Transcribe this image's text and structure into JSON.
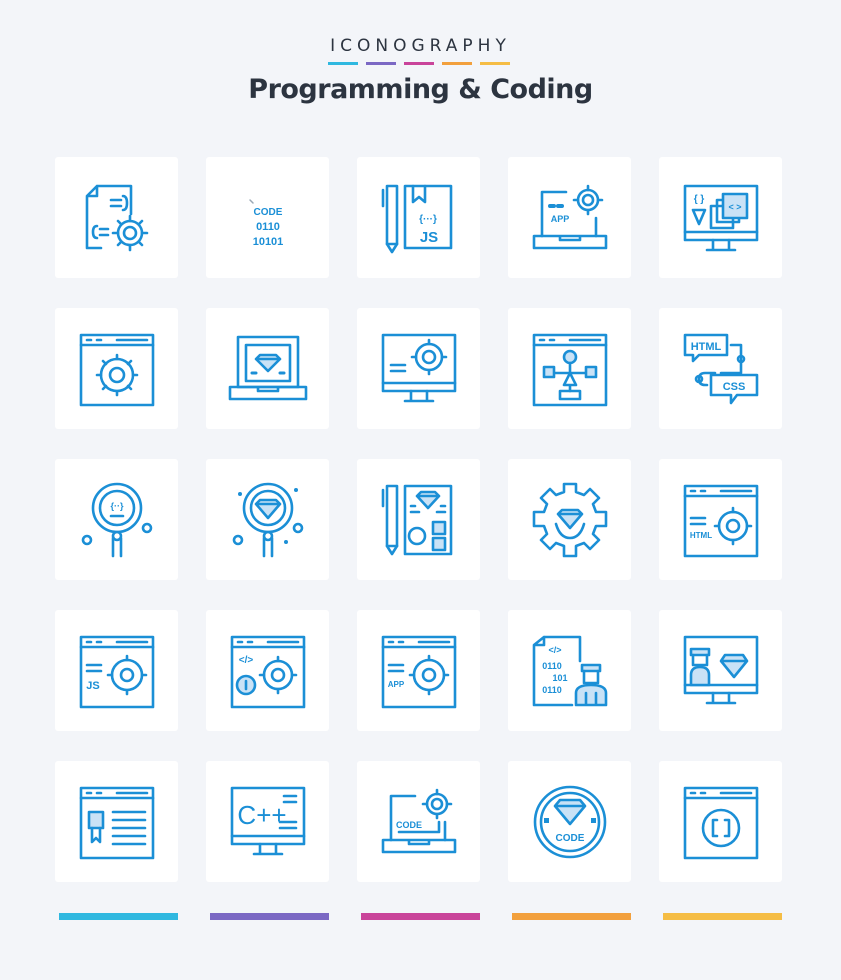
{
  "header": {
    "brand": "ICONOGRAPHY",
    "title": "Programming & Coding",
    "accent_colors": [
      "#2fb8e0",
      "#7b68c4",
      "#c9449a",
      "#f2a03d",
      "#f5bd45"
    ]
  },
  "icon_color": "#1b8fd6",
  "icons": [
    {
      "name": "code-settings-document-icon"
    },
    {
      "name": "binary-code-icon",
      "labels": [
        "CODE",
        "0110",
        "10101"
      ]
    },
    {
      "name": "javascript-book-pencil-icon",
      "labels": [
        "{···}",
        "JS"
      ]
    },
    {
      "name": "laptop-app-settings-icon",
      "labels": [
        "APP"
      ]
    },
    {
      "name": "monitor-code-layers-icon",
      "labels": [
        "{ }",
        "< >"
      ]
    },
    {
      "name": "browser-settings-icon"
    },
    {
      "name": "laptop-diamond-icon"
    },
    {
      "name": "monitor-settings-icon"
    },
    {
      "name": "browser-flowchart-icon"
    },
    {
      "name": "html-css-chat-icon",
      "labels": [
        "HTML",
        "CSS"
      ]
    },
    {
      "name": "magnifier-code-icon",
      "labels": [
        "{··}"
      ]
    },
    {
      "name": "magnifier-diamond-icon"
    },
    {
      "name": "pencil-diamond-document-icon"
    },
    {
      "name": "gear-diamond-icon"
    },
    {
      "name": "browser-html-settings-icon",
      "labels": [
        "HTML"
      ]
    },
    {
      "name": "browser-js-settings-icon",
      "labels": [
        "JS"
      ]
    },
    {
      "name": "browser-code-info-settings-icon",
      "labels": [
        "</>"
      ]
    },
    {
      "name": "browser-app-settings-icon",
      "labels": [
        "APP"
      ]
    },
    {
      "name": "developer-binary-document-icon",
      "labels": [
        "</>",
        "0110",
        "101",
        "0110"
      ]
    },
    {
      "name": "monitor-developer-diamond-icon"
    },
    {
      "name": "browser-certificate-icon"
    },
    {
      "name": "monitor-cpp-icon",
      "labels": [
        "C++"
      ]
    },
    {
      "name": "laptop-code-settings-icon",
      "labels": [
        "CODE"
      ]
    },
    {
      "name": "diamond-code-badge-icon",
      "labels": [
        "CODE"
      ]
    },
    {
      "name": "browser-brackets-icon",
      "labels": [
        "[ ]"
      ]
    }
  ]
}
